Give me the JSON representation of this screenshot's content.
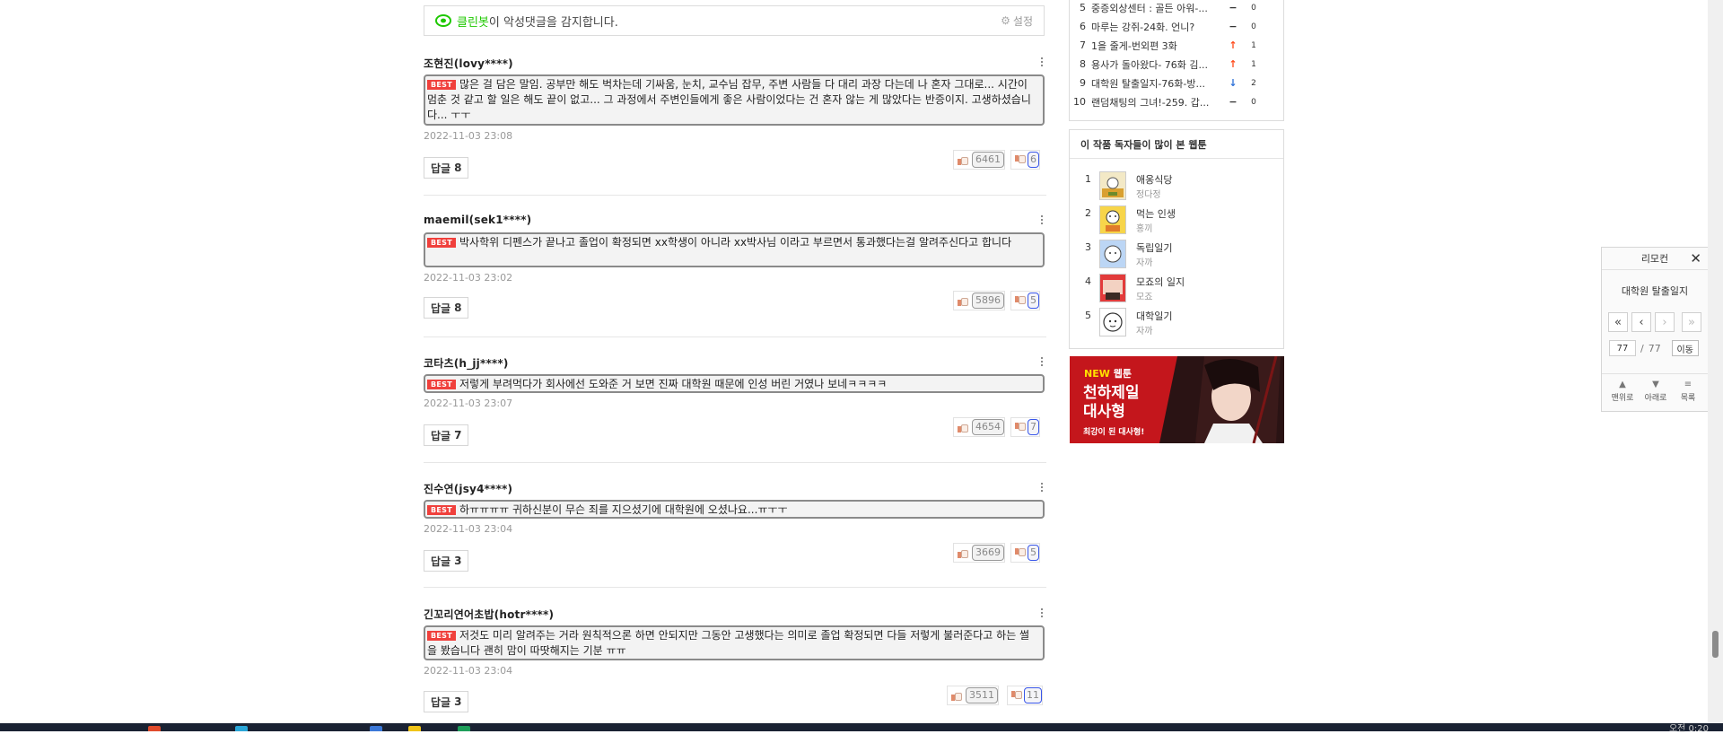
{
  "cleanbot": {
    "brand": "클린봇",
    "message": "이 악성댓글을 감지합니다.",
    "setting_label": "설정"
  },
  "comments": [
    {
      "author": "조현진(lovy****)",
      "badge": "BEST",
      "text": "많은 걸 담은 말임. 공부만 해도 벅차는데 기싸움, 눈치, 교수님 잡무, 주변 사람들 다 대리 과장 다는데 나 혼자 그대로... 시간이 멈춘 것 같고 할 일은 해도 끝이 없고... 그 과정에서 주변인들에게 좋은 사람이었다는 건 혼자 않는 게 많았다는 반증이지. 고생하셨습니다... ㅜㅜ",
      "date": "2022-11-03 23:08",
      "reply_label": "답글",
      "reply_count": "8",
      "likes": "6461",
      "dislikes": "6"
    },
    {
      "author": "maemil(sek1****)",
      "badge": "BEST",
      "text": "박사학위 디펜스가 끝나고 졸업이 확정되면 xx학생이 아니라 xx박사님 이라고 부르면서 통과했다는걸 알려주신다고 합니다",
      "date": "2022-11-03 23:02",
      "reply_label": "답글",
      "reply_count": "8",
      "likes": "5896",
      "dislikes": "5"
    },
    {
      "author": "코타츠(h_jj****)",
      "badge": "BEST",
      "text": "저렇게 부려먹다가 회사에선 도와준 거 보면 진짜 대학원 때문에 인성 버린 거였나 보네ㅋㅋㅋㅋ",
      "date": "2022-11-03 23:07",
      "reply_label": "답글",
      "reply_count": "7",
      "likes": "4654",
      "dislikes": "7"
    },
    {
      "author": "진수연(jsy4****)",
      "badge": "BEST",
      "text": "하ㅠㅠㅠㅠ 귀하신분이 무슨 죄를 지으셨기에 대학원에 오셨나요...ㅠㅜㅜ",
      "date": "2022-11-03 23:04",
      "reply_label": "답글",
      "reply_count": "3",
      "likes": "3669",
      "dislikes": "5"
    },
    {
      "author": "긴꼬리연어초밥(hotr****)",
      "badge": "BEST",
      "text": "저것도 미리 알려주는 거라 원칙적으론 하면 안되지만 그동안 고생했다는 의미로 졸업 확정되면 다들 저렇게 불러준다고 하는 썰을 봤습니다 괜히 맘이 따땃해지는 기분 ㅠㅠ",
      "date": "2022-11-03 23:04",
      "reply_label": "답글",
      "reply_count": "3",
      "likes": "3511",
      "dislikes": "11"
    }
  ],
  "ranking": [
    {
      "no": "5",
      "title": "중증외상센터 : 골든 아워-...",
      "change": "−",
      "change_dir": "same",
      "value": "0"
    },
    {
      "no": "6",
      "title": "마루는 강쥐-24화. 언니?",
      "change": "−",
      "change_dir": "same",
      "value": "0"
    },
    {
      "no": "7",
      "title": "1을 줄게-번외편 3화",
      "change": "↑",
      "change_dir": "up",
      "value": "1"
    },
    {
      "no": "8",
      "title": "용사가 돌아왔다- 76화 김...",
      "change": "↑",
      "change_dir": "up",
      "value": "1"
    },
    {
      "no": "9",
      "title": "대학원 탈출일지-76화-방...",
      "change": "↓",
      "change_dir": "down",
      "value": "2"
    },
    {
      "no": "10",
      "title": "랜덤채팅의 그녀!-259. 갑...",
      "change": "−",
      "change_dir": "same",
      "value": "0"
    }
  ],
  "popular": {
    "heading": "이 작품 독자들이 많이 본 웹툰",
    "items": [
      {
        "no": "1",
        "title": "애옹식당",
        "author": "정다정"
      },
      {
        "no": "2",
        "title": "먹는 인생",
        "author": "홍끼"
      },
      {
        "no": "3",
        "title": "독립일기",
        "author": "자까"
      },
      {
        "no": "4",
        "title": "모죠의 일지",
        "author": "모죠"
      },
      {
        "no": "5",
        "title": "대학일기",
        "author": "자까"
      }
    ]
  },
  "banner": {
    "new_label": "NEW",
    "new_suffix": "웹툰",
    "title_line1": "천하제일",
    "title_line2": "대사형",
    "tagline": "최강이 된 대사형!"
  },
  "remote": {
    "title": "리모컨",
    "webtoon_title": "대학원 탈출일지",
    "first_icon": "«",
    "prev_icon": "‹",
    "next_icon": "›",
    "last_icon": "»",
    "current_page": "77",
    "separator": "/",
    "total_pages": "77",
    "go_label": "이동",
    "top_label": "맨위로",
    "bottom_label": "아래로",
    "list_label": "목록"
  },
  "taskbar": {
    "clock": "오전 0:20"
  },
  "colors": {
    "best_badge": "#f0403c",
    "cleanbot_brand": "#1ec800",
    "rank_up": "#ff4a1a",
    "rank_down": "#2c70d8",
    "banner_bg": "#c4161c"
  }
}
